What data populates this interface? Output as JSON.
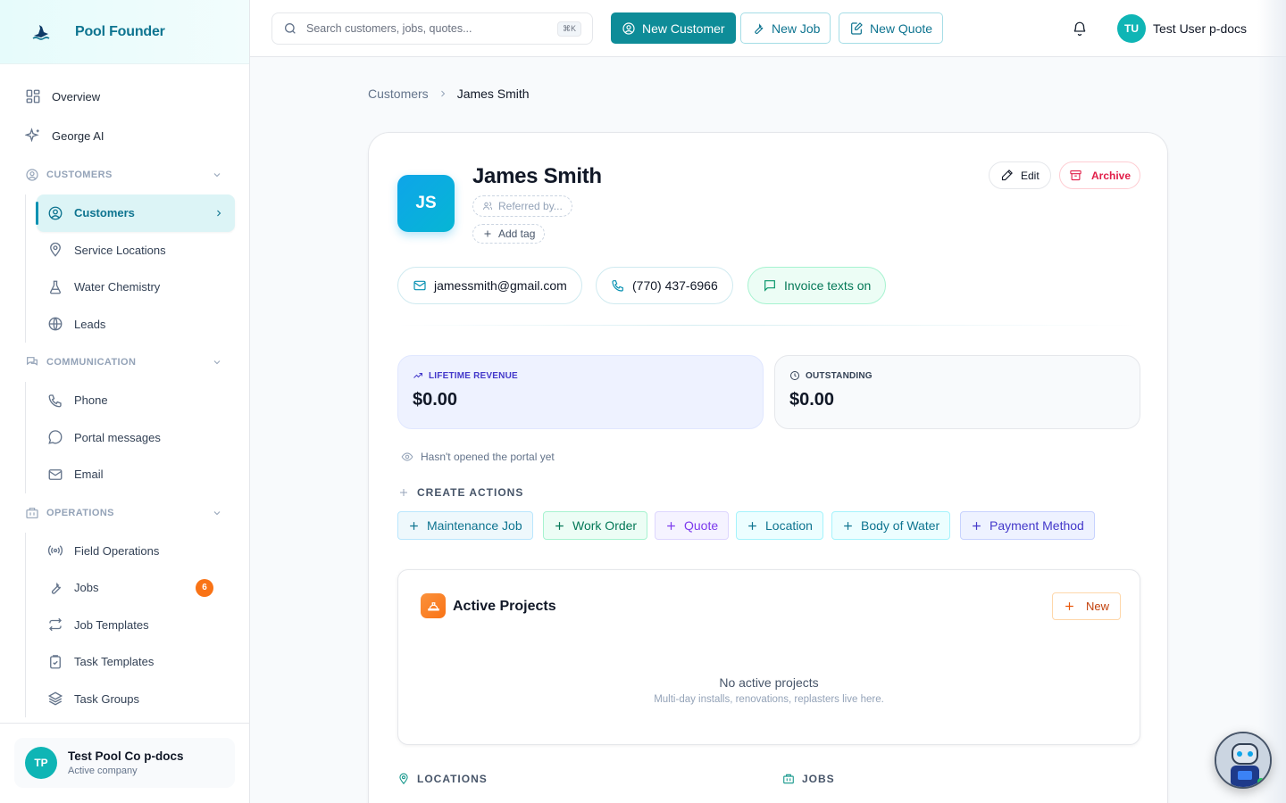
{
  "brand": {
    "name": "Pool Founder"
  },
  "nav": {
    "overview": "Overview",
    "george": "George AI",
    "customers_section": "CUSTOMERS",
    "customers_items": [
      "Customers",
      "Service Locations",
      "Water Chemistry",
      "Leads"
    ],
    "communication_section": "COMMUNICATION",
    "communication_items": [
      "Phone",
      "Portal messages",
      "Email"
    ],
    "operations_section": "OPERATIONS",
    "operations_items": [
      "Field Operations",
      "Jobs",
      "Job Templates",
      "Task Templates",
      "Task Groups"
    ],
    "jobs_badge": "6"
  },
  "company": {
    "initials": "TP",
    "name": "Test Pool Co p-docs",
    "status": "Active company"
  },
  "topbar": {
    "search_placeholder": "Search customers, jobs, quotes...",
    "shortcut": "⌘K",
    "new_customer": "New Customer",
    "new_job": "New Job",
    "new_quote": "New Quote",
    "user_initials": "TU",
    "user_name": "Test User p-docs"
  },
  "breadcrumb": {
    "parent": "Customers",
    "current": "James Smith"
  },
  "customer": {
    "initials": "JS",
    "name": "James Smith",
    "referred": "Referred by...",
    "add_tag": "Add tag",
    "edit": "Edit",
    "archive": "Archive",
    "email": "jamessmith@gmail.com",
    "phone": "(770) 437-6966",
    "invoice_texts": "Invoice texts on"
  },
  "stats": {
    "revenue_label": "LIFETIME REVENUE",
    "revenue_value": "$0.00",
    "outstanding_label": "OUTSTANDING",
    "outstanding_value": "$0.00"
  },
  "portal_status": "Hasn't opened the portal yet",
  "create_actions": {
    "title": "CREATE ACTIONS",
    "items": [
      "Maintenance Job",
      "Work Order",
      "Quote",
      "Location",
      "Body of Water",
      "Payment Method"
    ]
  },
  "projects": {
    "title": "Active Projects",
    "new": "New",
    "empty_title": "No active projects",
    "empty_sub": "Multi-day installs, renovations, replasters live here."
  },
  "sections": {
    "locations": "LOCATIONS",
    "jobs": "JOBS"
  },
  "colors": {
    "primary": "#0e8c98",
    "accent": "#0e7490",
    "danger": "#e11d48",
    "badge": "#f97316"
  }
}
